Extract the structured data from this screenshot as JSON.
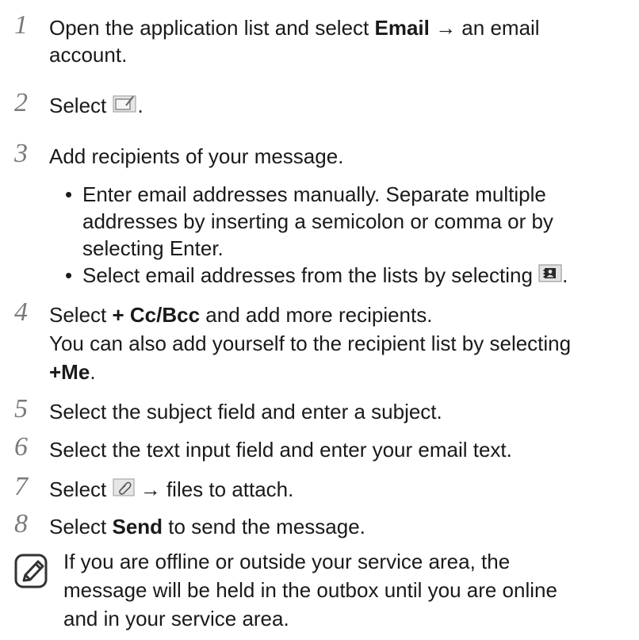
{
  "steps": [
    {
      "num": "1",
      "line1_pre": "Open the application list and select ",
      "line1_bold": "Email",
      "line1_post": " → an email",
      "line2": "account."
    },
    {
      "num": "2",
      "pre": "Select ",
      "post": ".",
      "icon": "compose-icon"
    },
    {
      "num": "3",
      "text": "Add recipients of your message.",
      "bullets": [
        {
          "line1": "Enter email addresses manually. Separate multiple",
          "line2": "addresses by inserting a semicolon or comma or by",
          "line3": "selecting Enter."
        },
        {
          "pre": "Select email addresses from the lists by selecting ",
          "post": ".",
          "icon": "contacts-icon"
        }
      ]
    },
    {
      "num": "4",
      "line1_pre": "Select ",
      "line1_bold": "+ Cc/Bcc",
      "line1_post": " and add more recipients.",
      "line2": "You can also add yourself to the recipient list by selecting",
      "line3_bold": "+Me",
      "line3_post": "."
    },
    {
      "num": "5",
      "text": "Select the subject field and enter a subject."
    },
    {
      "num": "6",
      "text": "Select the text input field and enter your email text."
    },
    {
      "num": "7",
      "pre": "Select ",
      "post": " → files to attach.",
      "icon": "attach-icon"
    },
    {
      "num": "8",
      "pre": "Select ",
      "bold": "Send",
      "post": " to send the message."
    }
  ],
  "bullet_char": "•",
  "note": {
    "icon": "note-pencil-icon",
    "line1": "If you are offline or outside your service area, the",
    "line2": "message will be held in the outbox until you are online",
    "line3": "and in your service area."
  }
}
